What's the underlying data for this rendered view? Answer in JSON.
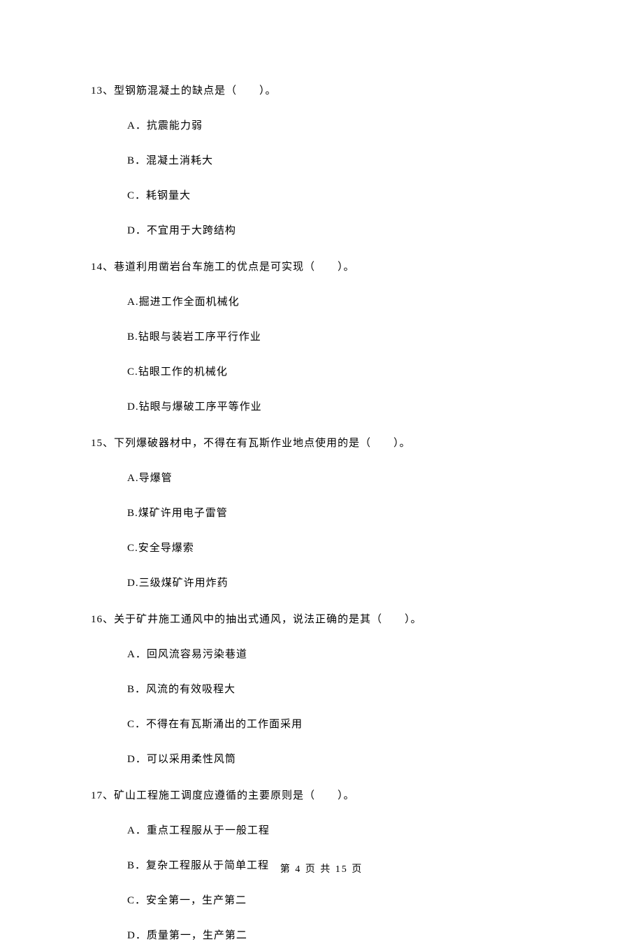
{
  "questions": [
    {
      "number": "13、",
      "text": "型钢筋混凝土的缺点是（　　）。",
      "options": [
        "A．抗震能力弱",
        "B．混凝土消耗大",
        "C．耗钢量大",
        "D．不宜用于大跨结构"
      ]
    },
    {
      "number": "14、",
      "text": "巷道利用凿岩台车施工的优点是可实现（　　）。",
      "options": [
        "A.掘进工作全面机械化",
        "B.钻眼与装岩工序平行作业",
        "C.钻眼工作的机械化",
        "D.钻眼与爆破工序平等作业"
      ]
    },
    {
      "number": "15、",
      "text": "下列爆破器材中，不得在有瓦斯作业地点使用的是（　　）。",
      "options": [
        "A.导爆管",
        "B.煤矿许用电子雷管",
        "C.安全导爆索",
        "D.三级煤矿许用炸药"
      ]
    },
    {
      "number": "16、",
      "text": "关于矿井施工通风中的抽出式通风，说法正确的是其（　　）。",
      "options": [
        "A．回风流容易污染巷道",
        "B．风流的有效吸程大",
        "C．不得在有瓦斯涌出的工作面采用",
        "D．可以采用柔性风筒"
      ]
    },
    {
      "number": "17、",
      "text": "矿山工程施工调度应遵循的主要原则是（　　）。",
      "options": [
        "A．重点工程服从于一般工程",
        "B．复杂工程服从于简单工程",
        "C．安全第一，生产第二",
        "D．质量第一，生产第二"
      ]
    }
  ],
  "footer": "第 4 页 共 15 页"
}
